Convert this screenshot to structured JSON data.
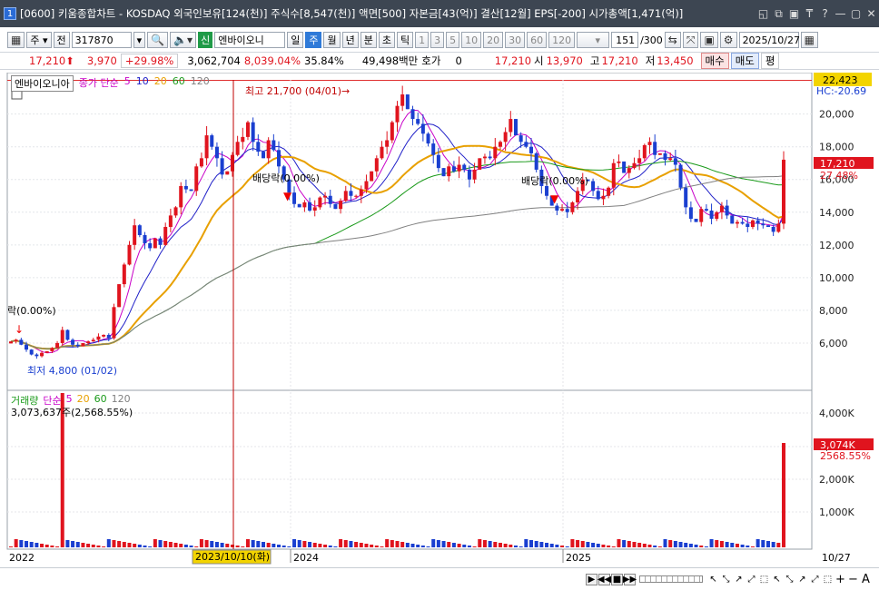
{
  "titlebar": {
    "window_no": "1",
    "title": "[0600] 키움종합차트 - KOSDAQ 외국인보유[124(천)] 주식수[8,547(천)] 액면[500] 자본금[43(억)] 결산[12월] EPS[-200] 시가총액[1,471(억)]",
    "btns": [
      "◱",
      "⧉",
      "▣",
      "₸",
      "?",
      "—",
      "▢",
      "✕"
    ]
  },
  "toolbar": {
    "market": "주",
    "code_btn": "전",
    "code": "317870",
    "stock_name": "엔바이오니",
    "badge": "신",
    "periods": [
      "일",
      "주",
      "월",
      "년",
      "분",
      "초",
      "틱"
    ],
    "active_period": "주",
    "intervals": [
      "1",
      "3",
      "5",
      "10",
      "20",
      "30",
      "60",
      "120"
    ],
    "count": "151",
    "count_total": "/300",
    "date": "2025/10/27"
  },
  "price": {
    "last": "17,210",
    "arrow": "⬆",
    "change": "3,970",
    "change_pct": "+29.98%",
    "volume": "3,062,704",
    "vol_pct": "8,039.04%",
    "turnover": "35.84%",
    "amount": "49,498백만",
    "hoga_label": "호가",
    "hoga": "0",
    "ask": "17,210",
    "open_label": "시",
    "open": "13,970",
    "high_label": "고",
    "high": "17,210",
    "low_label": "저",
    "low": "13,450",
    "buy": "매수",
    "sell": "매도",
    "avg": "평"
  },
  "legend": {
    "name": "엔바이오니아",
    "ma_label": "종가 단순",
    "ma": [
      "5",
      "10",
      "20",
      "60",
      "120"
    ],
    "ma_colors": [
      "#c800c8",
      "#2020c8",
      "#e8a000",
      "#1a9a1a",
      "#808080"
    ]
  },
  "vol_legend": {
    "name": "거래량",
    "ma_label": "단순",
    "ma": [
      "5",
      "20",
      "60",
      "120"
    ],
    "info": "3,073,637주(2,568.55%)"
  },
  "right_axis": {
    "top_label": "22,423",
    "hc_label": "HC:-20.69",
    "price_ticks": [
      "20,000",
      "18,000",
      "16,000",
      "14,000",
      "12,000",
      "10,000",
      "8,000",
      "6,000"
    ],
    "last_price": "17,210",
    "last_pct": "27.48%",
    "vol_ticks": [
      "4,000K",
      "3,000K",
      "2,000K",
      "1,000K"
    ],
    "vol_last": "3,074K",
    "vol_pct": "2568.55%",
    "date_end": "10/27"
  },
  "annotations": {
    "high": "최고 21,700 (04/01)",
    "low": "최저 4,800 (01/02)",
    "div1": "배당락(0.00%)",
    "div2": "배당락(0.00%)",
    "div0": "락(0.00%)"
  },
  "x_axis": {
    "labels": [
      "2022",
      "2024",
      "2025"
    ],
    "crosshair_date": "2023/10/10(화)"
  },
  "bottom": {
    "nav": [
      "▶",
      "◀◀",
      "■",
      "▶▶"
    ],
    "icons": [
      "↖",
      "⤡",
      "↗",
      "⤢",
      "⬚",
      "↖",
      "⤡",
      "↗",
      "⤢",
      "⬚",
      "+",
      "−",
      "A"
    ]
  },
  "colors": {
    "up": "#e0141e",
    "down": "#1a3fd0",
    "accent": "#2f7ad8"
  },
  "chart_data": {
    "type": "candlestick",
    "title": "",
    "price_range": [
      3500,
      22423
    ],
    "closes": [
      6100,
      6200,
      5900,
      5600,
      5300,
      5200,
      5400,
      5500,
      5700,
      6000,
      6800,
      6200,
      5900,
      5800,
      6000,
      6100,
      6200,
      6400,
      6500,
      6300,
      8200,
      9600,
      10800,
      12000,
      13200,
      12600,
      12100,
      11800,
      12400,
      12000,
      13100,
      13800,
      14300,
      15600,
      15400,
      15300,
      16800,
      17300,
      18700,
      18000,
      17300,
      16300,
      16500,
      17500,
      18300,
      18600,
      19500,
      18300,
      17700,
      17300,
      18400,
      17800,
      16800,
      16000,
      15200,
      14500,
      14300,
      14600,
      14100,
      14300,
      14900,
      15000,
      14500,
      14200,
      14700,
      15300,
      15000,
      15000,
      15400,
      15900,
      16500,
      17300,
      18000,
      18400,
      19500,
      20500,
      21200,
      20300,
      19700,
      19400,
      18800,
      18200,
      17500,
      16700,
      16200,
      16800,
      16500,
      16900,
      16600,
      16000,
      16600,
      17300,
      17400,
      17300,
      18000,
      18300,
      18900,
      19700,
      18700,
      18300,
      18000,
      17600,
      16600,
      15600,
      15000,
      14400,
      14100,
      14200,
      14000,
      14600,
      15300,
      16000,
      15900,
      15300,
      14800,
      15000,
      15500,
      17000,
      17100,
      16400,
      16700,
      17000,
      17300,
      18100,
      18300,
      17500,
      17600,
      17200,
      17300,
      16900,
      15500,
      14300,
      13600,
      13400,
      14200,
      14100,
      13600,
      14000,
      14400,
      13800,
      13300,
      13400,
      13300,
      13100,
      13500,
      13300,
      13200,
      13100,
      12800,
      13300,
      17210
    ],
    "volume_last": 3073637
  }
}
